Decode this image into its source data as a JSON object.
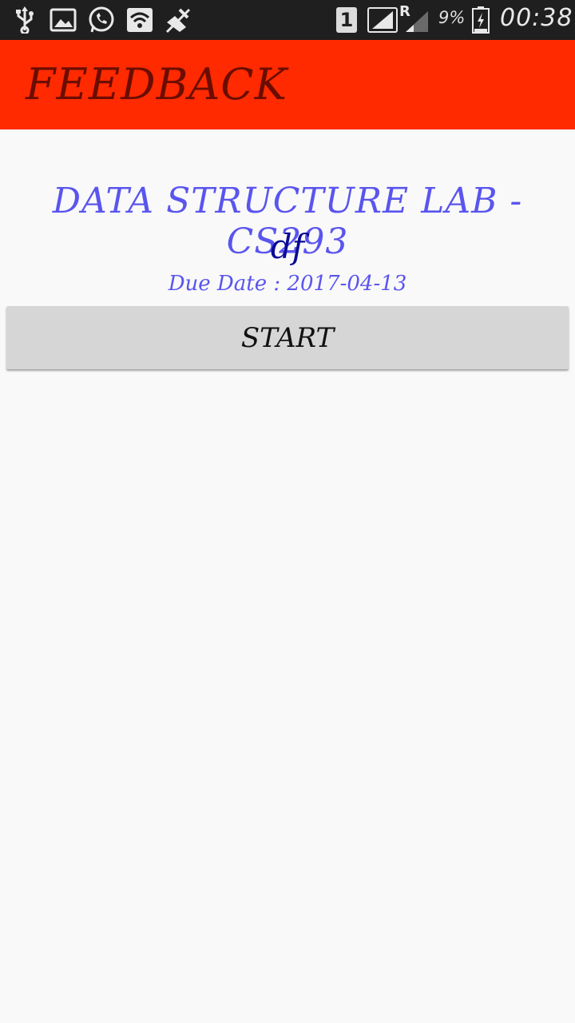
{
  "status_bar": {
    "icons": [
      "usb-icon",
      "image-icon",
      "whatsapp-icon",
      "wifi-icon",
      "mute-icon",
      "sim-icon",
      "signal-icon",
      "roaming-signal-icon",
      "battery-icon"
    ],
    "sim_slot": "1",
    "roaming_indicator": "R",
    "battery_percent": "9%",
    "time": "00:38"
  },
  "app_bar": {
    "title": "FEEDBACK",
    "color": "#ff2a00"
  },
  "content": {
    "course_title": "DATA STRUCTURE LAB - CS293",
    "subtitle": "df",
    "due_date": "Due Date : 2017-04-13",
    "start_label": "START"
  }
}
